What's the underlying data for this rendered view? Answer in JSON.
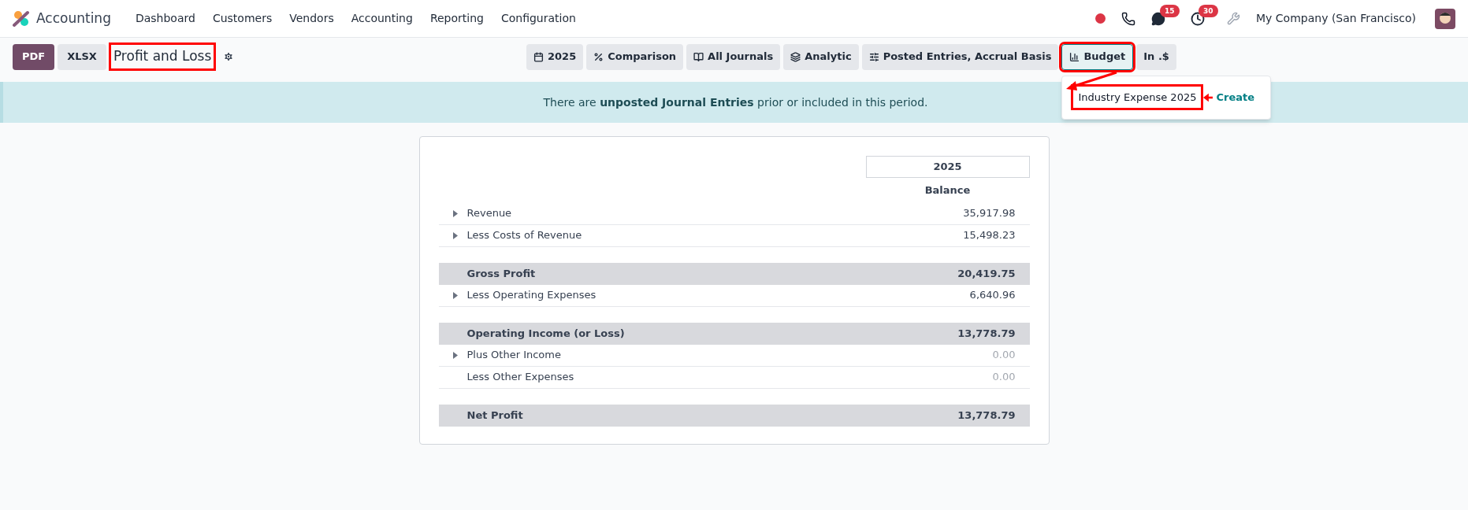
{
  "navbar": {
    "app_name": "Accounting",
    "menu": [
      "Dashboard",
      "Customers",
      "Vendors",
      "Accounting",
      "Reporting",
      "Configuration"
    ],
    "chat_count": "15",
    "activity_count": "30",
    "company": "My Company (San Francisco)"
  },
  "toolbar": {
    "exports": [
      "PDF",
      "XLSX"
    ],
    "title": "Profit and Loss",
    "title_highlighted": true,
    "filters": [
      {
        "label": "2025",
        "selected": false,
        "highlighted": false
      },
      {
        "label": "Comparison",
        "selected": false,
        "highlighted": false
      },
      {
        "label": "All Journals",
        "selected": false,
        "highlighted": false
      },
      {
        "label": "Analytic",
        "selected": false,
        "highlighted": false
      },
      {
        "label": "Posted Entries, Accrual Basis",
        "selected": false,
        "highlighted": false
      },
      {
        "label": "Budget",
        "selected": true,
        "highlighted": true
      },
      {
        "label": "In .$",
        "selected": false,
        "highlighted": false
      }
    ]
  },
  "budget_dropdown": {
    "item": "Industry Expense 2025",
    "item_highlighted": true,
    "action": "Create"
  },
  "banner": "There are **unposted Journal Entries** prior or included in this period.",
  "report": {
    "period": "2025",
    "column": "Balance",
    "rows": [
      {
        "kind": "line",
        "label": "Revenue",
        "value": "35,917.98",
        "expandable": true,
        "muted": false
      },
      {
        "kind": "line",
        "label": "Less Costs of Revenue",
        "value": "15,498.23",
        "expandable": true,
        "muted": false
      },
      {
        "kind": "total",
        "label": "Gross Profit",
        "value": "20,419.75",
        "expandable": false,
        "muted": false
      },
      {
        "kind": "line",
        "label": "Less Operating Expenses",
        "value": "6,640.96",
        "expandable": true,
        "muted": false
      },
      {
        "kind": "total",
        "label": "Operating Income (or Loss)",
        "value": "13,778.79",
        "expandable": false,
        "muted": false
      },
      {
        "kind": "line",
        "label": "Plus Other Income",
        "value": "0.00",
        "expandable": true,
        "muted": true
      },
      {
        "kind": "line",
        "label": "Less Other Expenses",
        "value": "0.00",
        "expandable": false,
        "muted": true
      },
      {
        "kind": "total",
        "label": "Net Profit",
        "value": "13,778.79",
        "expandable": false,
        "muted": false
      }
    ]
  }
}
